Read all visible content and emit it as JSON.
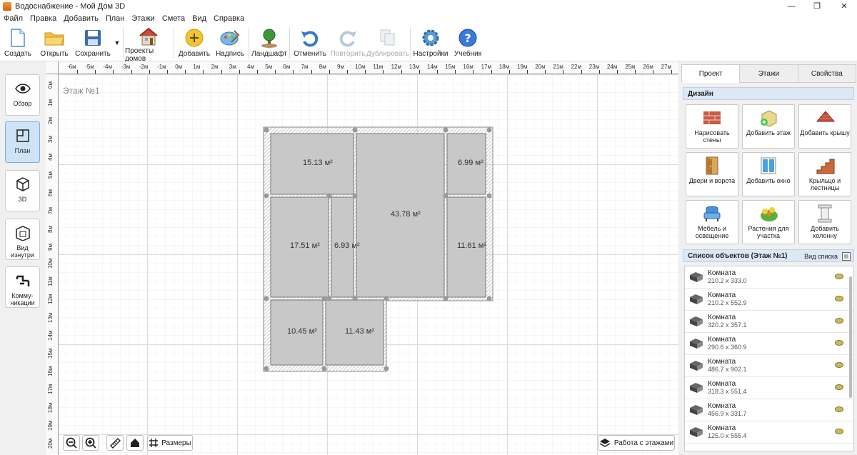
{
  "window": {
    "title": "Водоснабжение - Мой Дом 3D",
    "minimize": "—",
    "maximize": "❐",
    "close": "✕"
  },
  "menu": [
    "Файл",
    "Правка",
    "Добавить",
    "План",
    "Этажи",
    "Смета",
    "Вид",
    "Справка"
  ],
  "toolbar": {
    "create": "Создать",
    "open": "Открыть",
    "save": "Сохранить",
    "projects": "Проекты домов",
    "add": "Добавить",
    "label": "Надпись",
    "landscape": "Ландшафт",
    "undo": "Отменить",
    "redo": "Повторить",
    "duplicate": "Дублировать",
    "settings": "Настройки",
    "tutorial": "Учебник"
  },
  "sidebar": {
    "overview": "Обзор",
    "plan": "План",
    "view3d": "3D",
    "inside": "Вид изнутри",
    "comm": "Комму-никации"
  },
  "canvas": {
    "floor_label": "Этаж №1",
    "ruler_top": [
      "-6м",
      "-5м",
      "-4м",
      "-3м",
      "-2м",
      "-1м",
      "0м",
      "1м",
      "2м",
      "3м",
      "4м",
      "5м",
      "6м",
      "7м",
      "8м",
      "9м",
      "10м",
      "11м",
      "12м",
      "13м",
      "14м",
      "15м",
      "16м",
      "17м",
      "18м",
      "19м",
      "20м",
      "21м",
      "22м",
      "23м",
      "24м",
      "25м",
      "26м",
      "27м"
    ],
    "ruler_left": [
      "0м",
      "1м",
      "2м",
      "3м",
      "4м",
      "5м",
      "6м",
      "7м",
      "8м",
      "9м",
      "10м",
      "11м",
      "12м",
      "13м",
      "14м",
      "15м",
      "16м",
      "17м",
      "18м",
      "19м",
      "20м"
    ],
    "rooms": [
      "15.13 м²",
      "6.99 м²",
      "43.78 м²",
      "17.51 м²",
      "6.93 м²",
      "11.61 м²",
      "10.45 м²",
      "11.43 м²"
    ],
    "sizes_btn": "Размеры",
    "floors_btn": "Работа с этажами"
  },
  "rightpanel": {
    "tabs": [
      "Проект",
      "Этажи",
      "Свойства"
    ],
    "design_header": "Дизайн",
    "design": [
      "Нарисовать стены",
      "Добавить этаж",
      "Добавить крышу",
      "Двери и ворота",
      "Добавить окно",
      "Крыльцо и лестницы",
      "Мебель и освещение",
      "Растения для участка",
      "Добавить колонну"
    ],
    "objlist_header": "Список объектов (Этаж №1)",
    "list_view": "Вид списка",
    "objects": [
      {
        "name": "Комната",
        "dim": "210.2 x 333.0"
      },
      {
        "name": "Комната",
        "dim": "210.2 x 552.9"
      },
      {
        "name": "Комната",
        "dim": "320.2 x 357.1"
      },
      {
        "name": "Комната",
        "dim": "290.6 x 360.9"
      },
      {
        "name": "Комната",
        "dim": "486.7 x 902.1"
      },
      {
        "name": "Комната",
        "dim": "318.3 x 551.4"
      },
      {
        "name": "Комната",
        "dim": "456.9 x 331.7"
      },
      {
        "name": "Комната",
        "dim": "125.0 x 555.4"
      }
    ]
  }
}
